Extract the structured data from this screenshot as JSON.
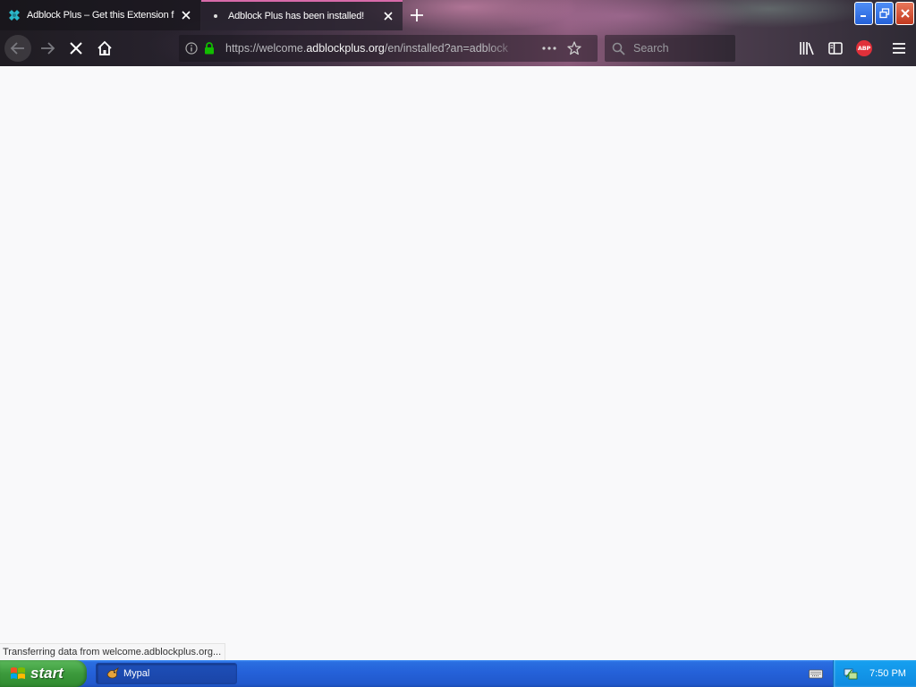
{
  "browser": {
    "tabs": [
      {
        "title": "Adblock Plus – Get this Extension f",
        "active": false,
        "favicon": "abp-puzzle-icon"
      },
      {
        "title": "Adblock Plus has been installed!",
        "active": true,
        "favicon": "loading-dot-icon"
      }
    ],
    "url": {
      "prefix": "https://welcome.",
      "host": "adblockplus.org",
      "path": "/en/installed?an=adblock"
    },
    "search": {
      "placeholder": "Search"
    },
    "abp_badge": "ABP",
    "status": "Transferring data from welcome.adblockplus.org..."
  },
  "taskbar": {
    "start_label": "start",
    "items": [
      {
        "label": "Mypal"
      }
    ],
    "clock": "7:50 PM"
  },
  "colors": {
    "active_tab_accent": "#d76aa9",
    "lock_green": "#12bc00",
    "abp_red": "#e0303a",
    "taskbar_blue": "#2460d8",
    "start_green": "#3c9a3c"
  }
}
